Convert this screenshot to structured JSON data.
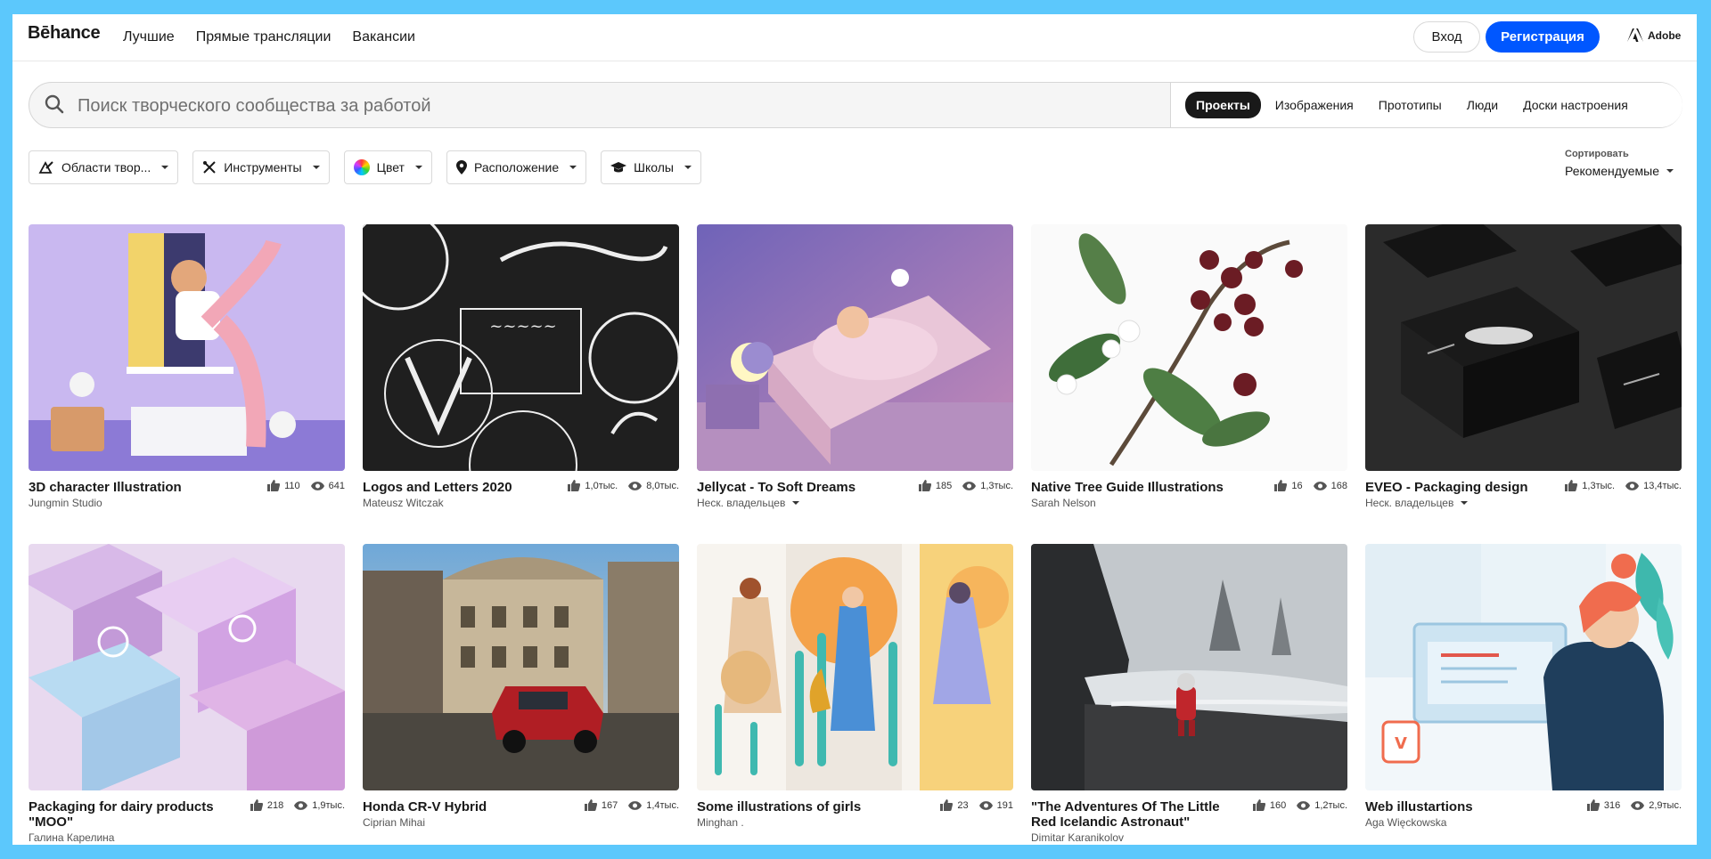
{
  "header": {
    "logo": "Bēhance",
    "nav": [
      "Лучшие",
      "Прямые трансляции",
      "Вакансии"
    ],
    "login": "Вход",
    "signup": "Регистрация",
    "adobe": "Adobe",
    "accent": "#0057ff"
  },
  "search": {
    "placeholder": "Поиск творческого сообщества за работой",
    "tabs": [
      "Проекты",
      "Изображения",
      "Прототипы",
      "Люди",
      "Доски настроения"
    ]
  },
  "filters": {
    "fields": "Области твор...",
    "tools": "Инструменты",
    "color": "Цвет",
    "location": "Расположение",
    "schools": "Школы"
  },
  "sort": {
    "label": "Сортировать",
    "value": "Рекомендуемые"
  },
  "projects": [
    {
      "title": "3D character Illustration",
      "owner": "Jungmin Studio",
      "likes": "110",
      "views": "641"
    },
    {
      "title": "Logos and Letters 2020",
      "owner": "Mateusz Witczak",
      "likes": "1,0тыс.",
      "views": "8,0тыс."
    },
    {
      "title": "Jellycat - To Soft Dreams",
      "owner": "Неск. владельцев",
      "likes": "185",
      "views": "1,3тыс."
    },
    {
      "title": "Native Tree Guide Illustrations",
      "owner": "Sarah Nelson",
      "likes": "16",
      "views": "168"
    },
    {
      "title": "EVEO - Packaging design",
      "owner": "Неск. владельцев",
      "likes": "1,3тыс.",
      "views": "13,4тыс."
    },
    {
      "title": "Packaging for dairy products \"MOO\"",
      "owner": "Галина Карелина",
      "likes": "218",
      "views": "1,9тыс."
    },
    {
      "title": "Honda CR-V Hybrid",
      "owner": "Ciprian Mihai",
      "likes": "167",
      "views": "1,4тыс."
    },
    {
      "title": "Some illustrations of girls",
      "owner": "Minghan .",
      "likes": "23",
      "views": "191"
    },
    {
      "title": "\"The Adventures Of The Little Red Icelandic Astronaut\"",
      "owner": "Dimitar Karanikolov",
      "likes": "160",
      "views": "1,2тыс."
    },
    {
      "title": "Web illustartions",
      "owner": "Aga Więckowska",
      "likes": "316",
      "views": "2,9тыс."
    }
  ]
}
